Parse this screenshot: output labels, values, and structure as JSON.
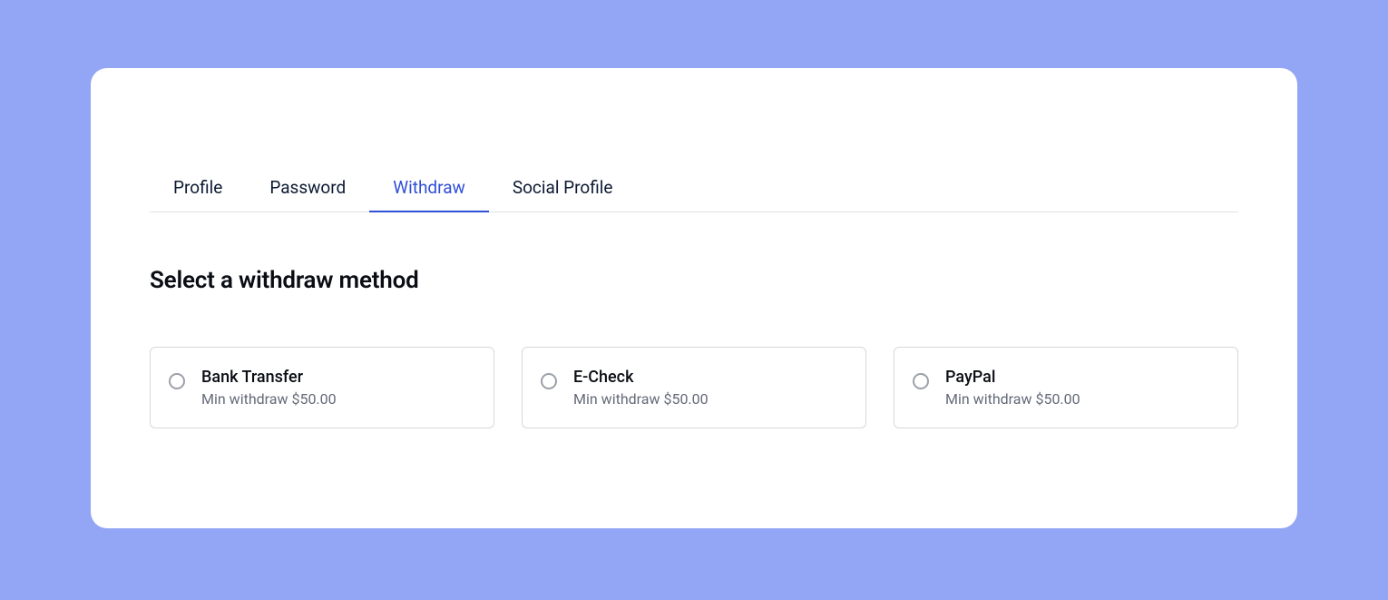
{
  "tabs": {
    "items": [
      {
        "label": "Profile",
        "active": false
      },
      {
        "label": "Password",
        "active": false
      },
      {
        "label": "Withdraw",
        "active": true
      },
      {
        "label": "Social Profile",
        "active": false
      }
    ]
  },
  "section": {
    "title": "Select a withdraw method"
  },
  "withdraw_methods": [
    {
      "label": "Bank Transfer",
      "sub": "Min withdraw $50.00"
    },
    {
      "label": "E-Check",
      "sub": "Min withdraw $50.00"
    },
    {
      "label": "PayPal",
      "sub": "Min withdraw $50.00"
    }
  ]
}
